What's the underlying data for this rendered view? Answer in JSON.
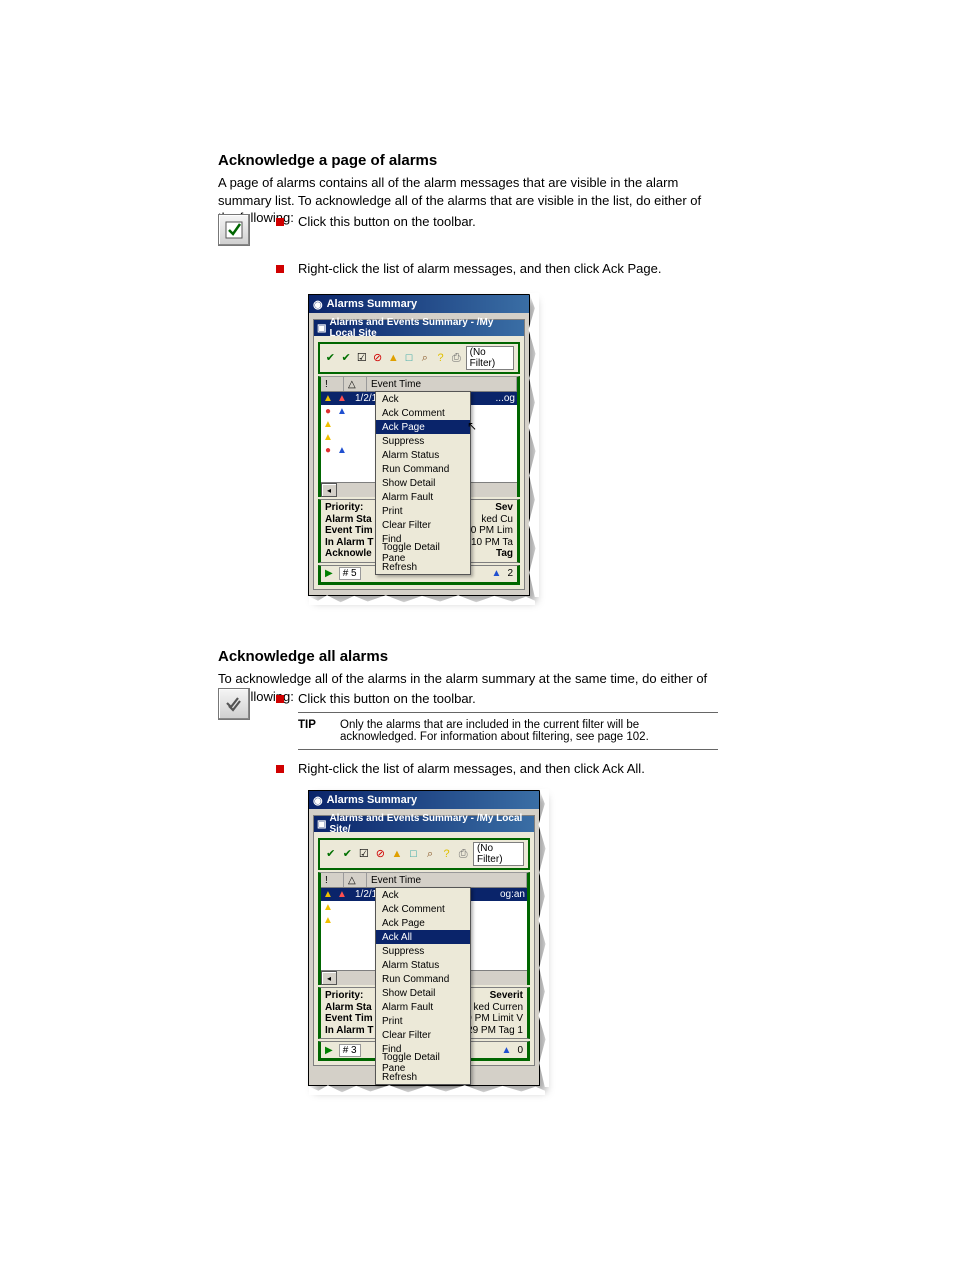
{
  "bullet1": "Click this button on the toolbar.",
  "bullet1b": "Right-click the list of alarm messages, and then click Ack Page.",
  "bullet2": "Click this button on the toolbar.",
  "bullet2b": "Right-click the list of alarm messages, and then click Ack All.",
  "ack_page_heading": "Acknowledge a page of alarms",
  "ack_page_intro": "A page of alarms contains all of the alarm messages that are visible in the alarm summary list. To acknowledge all of the alarms that are visible in the list, do either of the following:",
  "ack_all_heading": "Acknowledge all alarms",
  "ack_all_intro": "To acknowledge all of the alarms in the alarm summary at the same time, do either of the following:",
  "tip_text": "Only the alarms that are included in the current filter will be acknowledged. For information about filtering, see page 102.",
  "tip_label": "TIP",
  "win1": {
    "title": "Alarms Summary",
    "subtitle": "Alarms and Events Summary -  /My Local Site",
    "nofilter": "(No Filter)",
    "col_event_time": "Event Time",
    "row1_time": "1/2/1998 3:28:10 PM",
    "row1_tail": "...og",
    "menu": {
      "items": [
        "Ack",
        "Ack Comment",
        "Ack Page",
        "Suppress",
        "Alarm Status",
        "Run Command",
        "Show Detail",
        "Alarm Fault",
        "Print",
        "Clear Filter",
        "Find",
        "Toggle Detail Pane",
        "Refresh"
      ],
      "highlight": "Ack Page"
    },
    "details_left": [
      "Priority:",
      "Alarm Sta",
      "Event Tim",
      "In Alarm T",
      "Acknowle"
    ],
    "details_right": [
      "Sev",
      "ked   Cu",
      "10 PM   Lim",
      "10 PM   Ta",
      "Tag"
    ],
    "status_count": "# 5",
    "status_right": "2"
  },
  "win2": {
    "title": "Alarms Summary",
    "subtitle": "Alarms and Events Summary -  /My Local Site/",
    "nofilter": "(No Filter)",
    "col_event_time": "Event Time",
    "row1_time": "1/2/1998 3:33:29 PM",
    "row1_tail": "og:an",
    "menu": {
      "items": [
        "Ack",
        "Ack Comment",
        "Ack Page",
        "Ack All",
        "Suppress",
        "Alarm Status",
        "Run Command",
        "Show Detail",
        "Alarm Fault",
        "Print",
        "Clear Filter",
        "Find",
        "Toggle Detail Pane",
        "Refresh"
      ],
      "highlight": "Ack All"
    },
    "details_left": [
      "Priority:",
      "Alarm Sta",
      "Event Tim",
      "In Alarm T"
    ],
    "details_right": [
      "Severit",
      "ked   Curren",
      "29 PM   Limit V",
      "29 PM   Tag 1"
    ],
    "status_count": "# 3",
    "status_right": "0"
  }
}
